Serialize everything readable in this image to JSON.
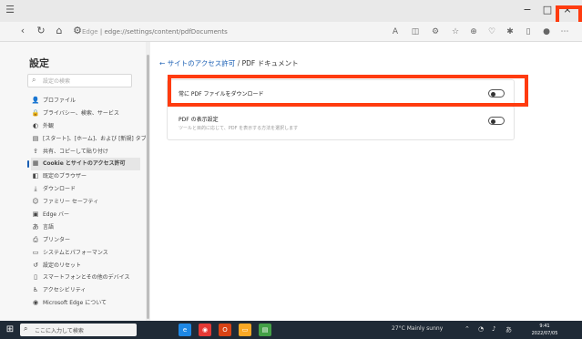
{
  "browser": {
    "url_scheme": "Edge",
    "url": "edge://settings/content/pdfDocuments",
    "title_buttons": {
      "minimize": "−",
      "maximize": "□",
      "close": "×"
    }
  },
  "sidebar": {
    "title": "設定",
    "search_placeholder": "設定の検索",
    "items": [
      {
        "icon": "profile-icon",
        "glyph": "👤",
        "label": "プロファイル"
      },
      {
        "icon": "lock-icon",
        "glyph": "🔒",
        "label": "プライバシー、検索、サービス"
      },
      {
        "icon": "appearance-icon",
        "glyph": "◐",
        "label": "外観"
      },
      {
        "icon": "start-page-icon",
        "glyph": "▤",
        "label": "[スタート]、[ホーム]、および [新規] タブ"
      },
      {
        "icon": "share-icon",
        "glyph": "⇪",
        "label": "共有、コピーして貼り付け"
      },
      {
        "icon": "cookie-site-permissions-icon",
        "glyph": "▦",
        "label": "Cookie とサイトのアクセス許可"
      },
      {
        "icon": "default-browser-icon",
        "glyph": "◧",
        "label": "既定のブラウザー"
      },
      {
        "icon": "download-icon",
        "glyph": "⤓",
        "label": "ダウンロード"
      },
      {
        "icon": "family-icon",
        "glyph": "☺",
        "label": "ファミリー セーフティ"
      },
      {
        "icon": "edge-bar-icon",
        "glyph": "▣",
        "label": "Edge バー"
      },
      {
        "icon": "languages-icon",
        "glyph": "あ",
        "label": "言語"
      },
      {
        "icon": "printer-icon",
        "glyph": "⎙",
        "label": "プリンター"
      },
      {
        "icon": "system-icon",
        "glyph": "▭",
        "label": "システムとパフォーマンス"
      },
      {
        "icon": "reset-icon",
        "glyph": "↺",
        "label": "設定のリセット"
      },
      {
        "icon": "phone-icon",
        "glyph": "▯",
        "label": "スマートフォンとその他のデバイス"
      },
      {
        "icon": "accessibility-icon",
        "glyph": "♿",
        "label": "アクセシビリティ"
      },
      {
        "icon": "edge-logo-icon",
        "glyph": "◉",
        "label": "Microsoft Edge について"
      }
    ],
    "active_index": 5
  },
  "main": {
    "breadcrumb_back": "←",
    "breadcrumb_parent": "サイトのアクセス許可",
    "breadcrumb_separator": " / ",
    "breadcrumb_current": "PDF ドキュメント",
    "settings": [
      {
        "label": "常に PDF ファイルをダウンロード",
        "description": "",
        "enabled": false
      },
      {
        "label": "PDF の表示設定",
        "description": "ツールと目的に応じて、PDF を表示する方法を選択します",
        "enabled": false
      }
    ]
  },
  "taskbar": {
    "search_placeholder": "ここに入力して検索",
    "weather": "27°C Mainly sunny",
    "clock_time": "9:41",
    "clock_date": "2022/07/05",
    "apps": [
      {
        "name": "edge-app-icon",
        "glyph": "e",
        "color": "#1e88e5"
      },
      {
        "name": "chrome-app-icon",
        "glyph": "◉",
        "color": "#e53935"
      },
      {
        "name": "office-app-icon",
        "glyph": "O",
        "color": "#d84315"
      },
      {
        "name": "file-explorer-icon",
        "glyph": "▭",
        "color": "#f9a825"
      },
      {
        "name": "store-app-icon",
        "glyph": "▤",
        "color": "#43a047"
      }
    ]
  }
}
